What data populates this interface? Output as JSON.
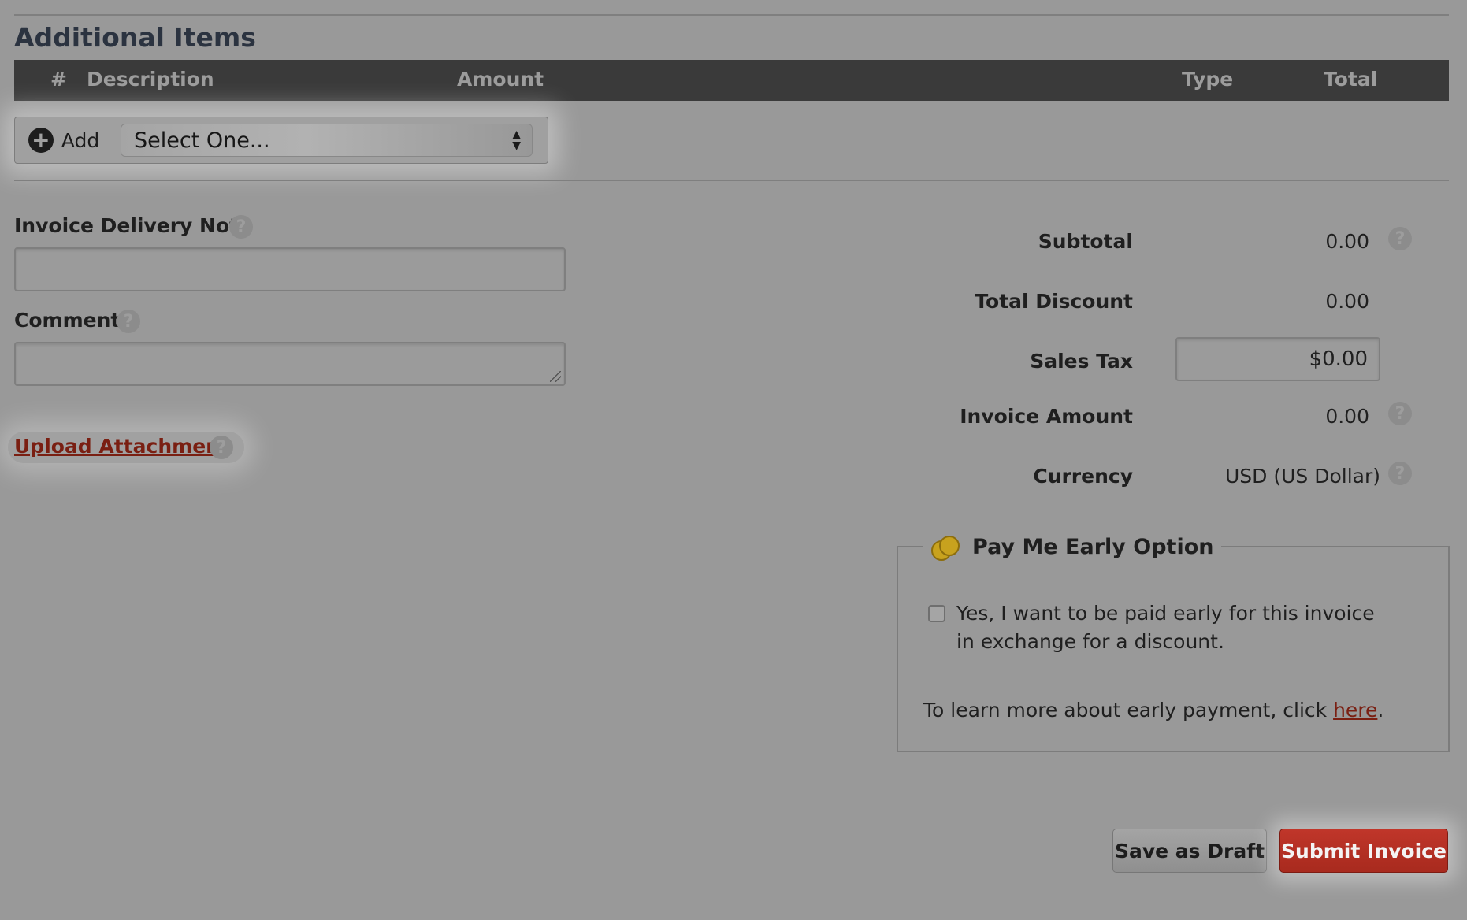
{
  "section": {
    "title": "Additional Items"
  },
  "table": {
    "columns": [
      "#",
      "Description",
      "Amount",
      "Type",
      "Total"
    ]
  },
  "add_row": {
    "add_label": "Add",
    "select_value": "Select One..."
  },
  "form": {
    "delivery_note_label": "Invoice Delivery Note",
    "delivery_note_value": "",
    "comment_label": "Comment",
    "comment_value": "",
    "upload_label": "Upload Attachment",
    "help_glyph": "?"
  },
  "summary": {
    "subtotal_label": "Subtotal",
    "subtotal_value": "0.00",
    "discount_label": "Total Discount",
    "discount_value": "0.00",
    "sales_tax_label": "Sales Tax",
    "sales_tax_value": "$0.00",
    "invoice_amount_label": "Invoice Amount",
    "invoice_amount_value": "0.00",
    "currency_label": "Currency",
    "currency_value": "USD (US Dollar)"
  },
  "early_pay": {
    "legend": "Pay Me Early Option",
    "checkbox_text": "Yes, I want to be paid early for this invoice in exchange for a discount.",
    "checked": false,
    "learn_more_prefix": "To learn more about early payment, click ",
    "learn_more_link": "here",
    "learn_more_suffix": "."
  },
  "buttons": {
    "save_draft": "Save as Draft",
    "submit": "Submit Invoice"
  },
  "colors": {
    "accent_red": "#b5301f",
    "link_red": "#7a1f12",
    "header_dark": "#3a3a3a",
    "coin_gold": "#c8a21e"
  },
  "icons": [
    "plus-circle-icon",
    "select-arrows-icon",
    "help-icon",
    "coins-icon",
    "checkbox-icon",
    "resize-grip-icon"
  ]
}
